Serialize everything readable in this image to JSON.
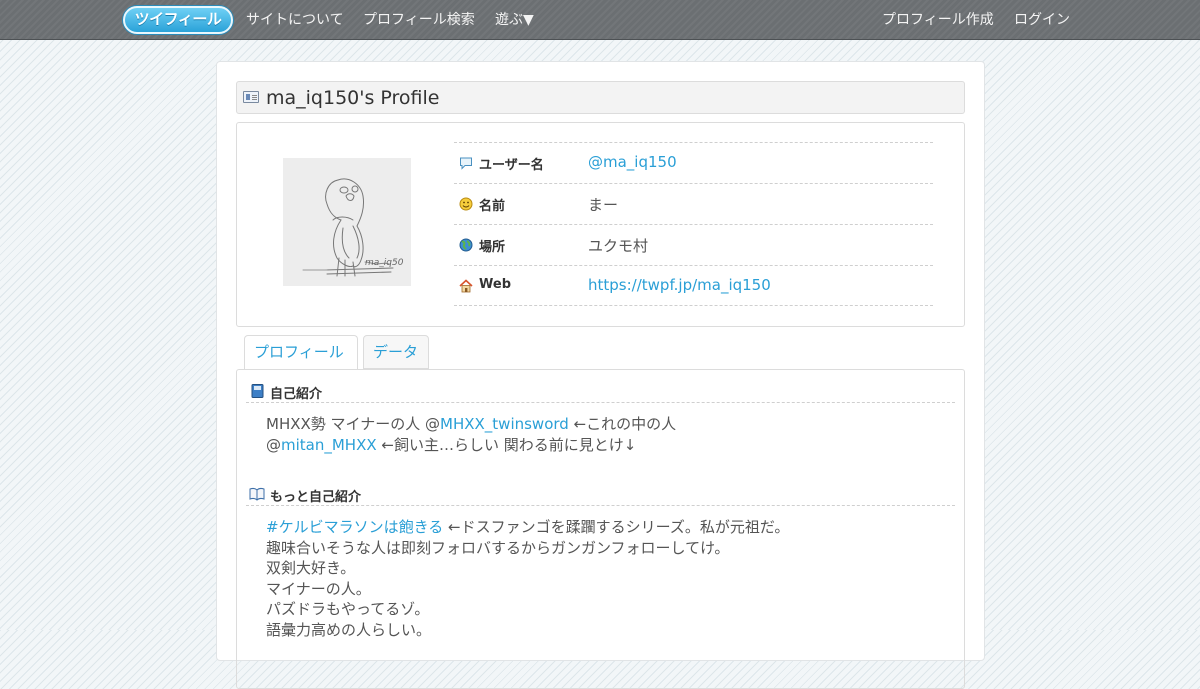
{
  "nav": {
    "logo": "ツイフィール",
    "items": [
      "サイトについて",
      "プロフィール検索",
      "遊ぶ▼"
    ],
    "right_items": [
      "プロフィール作成",
      "ログイン"
    ]
  },
  "profile": {
    "title": "ma_iq150's Profile",
    "avatar_alt": "parakeet sketch",
    "rows": [
      {
        "label": "ユーザー名",
        "value": "@ma_iq150",
        "icon": "speech-bubble-icon"
      },
      {
        "label": "名前",
        "value": "まー",
        "icon": "smiley-icon"
      },
      {
        "label": "場所",
        "value": "ユクモ村",
        "icon": "globe-icon"
      },
      {
        "label": "Web",
        "value": "https://twpf.jp/ma_iq150",
        "icon": "house-icon"
      }
    ]
  },
  "tabs": [
    "プロフィール",
    "データ"
  ],
  "sections": {
    "intro": {
      "heading": "自己紹介",
      "line1_a": "MHXX勢 マイナーの人 @",
      "line1_link": "MHXX_twinsword",
      "line1_b": " ←これの中の人",
      "line2_a": "@",
      "line2_link": "mitan_MHXX",
      "line2_b": " ←飼い主…らしい 関わる前に見とけ↓"
    },
    "more": {
      "heading": "もっと自己紹介",
      "line1_link": "#ケルビマラソンは飽きる",
      "line1_b": " ←ドスファンゴを蹂躙するシリーズ。私が元祖だ。",
      "lines": [
        "趣味合いそうな人は即刻フォロバするからガンガンフォローしてけ。",
        "双剣大好き。",
        "マイナーの人。",
        "パズドラもやってるゾ。",
        "語彙力高めの人らしい。"
      ]
    }
  },
  "colors": {
    "link": "#2a9fd6",
    "nav_bg": "#6b6f72"
  }
}
